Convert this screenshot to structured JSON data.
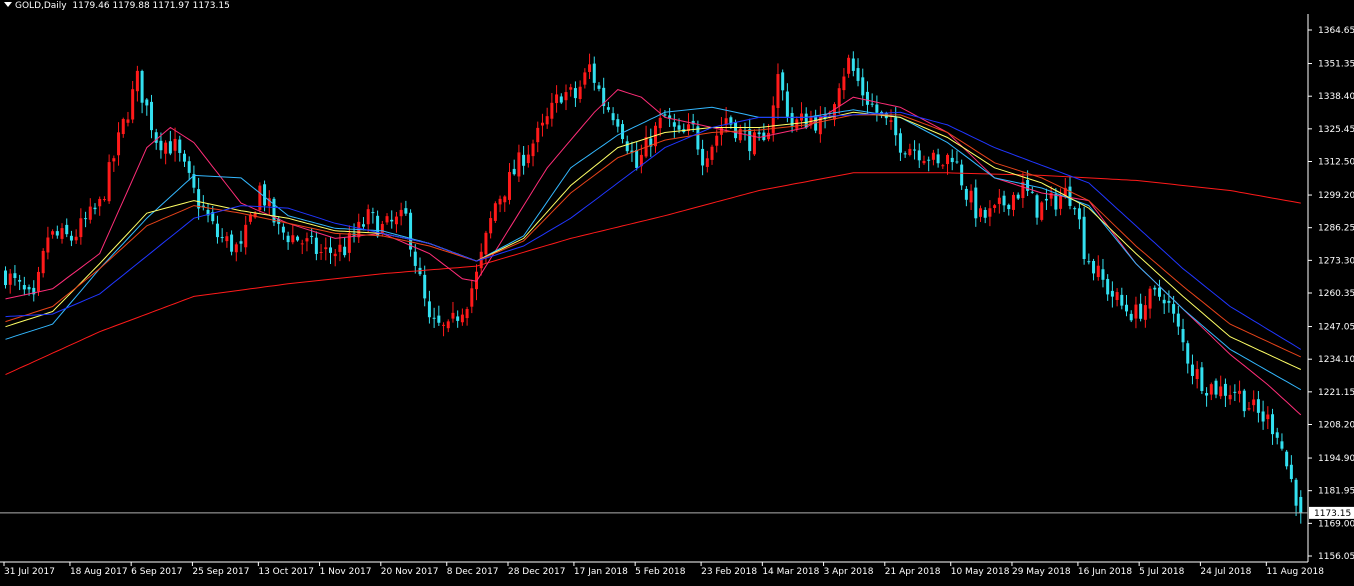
{
  "header": {
    "symbol": "GOLD,Daily",
    "ohlc": "1179.46 1179.88 1171.97 1173.15"
  },
  "chart_data": {
    "type": "candlestick",
    "symbol": "GOLD",
    "timeframe": "Daily",
    "ylim": [
      1151,
      1374
    ],
    "price_ticks": [
      "1364.65",
      "1351.35",
      "1338.40",
      "1325.45",
      "1312.50",
      "1299.20",
      "1286.25",
      "1273.30",
      "1260.35",
      "1247.05",
      "1234.10",
      "1221.15",
      "1208.20",
      "1194.90",
      "1181.95",
      "1169.00",
      "1156.05"
    ],
    "current_price": "1173.15",
    "date_ticks": [
      {
        "label": "31 Jul 2017",
        "index": 0
      },
      {
        "label": "18 Aug 2017",
        "index": 14
      },
      {
        "label": "6 Sep 2017",
        "index": 27
      },
      {
        "label": "25 Sep 2017",
        "index": 40
      },
      {
        "label": "13 Oct 2017",
        "index": 54
      },
      {
        "label": "1 Nov 2017",
        "index": 67
      },
      {
        "label": "20 Nov 2017",
        "index": 80
      },
      {
        "label": "8 Dec 2017",
        "index": 94
      },
      {
        "label": "28 Dec 2017",
        "index": 107
      },
      {
        "label": "17 Jan 2018",
        "index": 121
      },
      {
        "label": "5 Feb 2018",
        "index": 134
      },
      {
        "label": "23 Feb 2018",
        "index": 148
      },
      {
        "label": "14 Mar 2018",
        "index": 161
      },
      {
        "label": "3 Apr 2018",
        "index": 174
      },
      {
        "label": "21 Apr 2018",
        "index": 187
      },
      {
        "label": "10 May 2018",
        "index": 201
      },
      {
        "label": "29 May 2018",
        "index": 214
      },
      {
        "label": "16 Jun 2018",
        "index": 228
      },
      {
        "label": "5 Jul 2018",
        "index": 241
      },
      {
        "label": "24 Jul 2018",
        "index": 254
      },
      {
        "label": "11 Aug 2018",
        "index": 268
      }
    ],
    "close_path": [
      [
        0,
        1268
      ],
      [
        6,
        1256
      ],
      [
        9,
        1283
      ],
      [
        14,
        1282
      ],
      [
        20,
        1295
      ],
      [
        25,
        1327
      ],
      [
        28,
        1345
      ],
      [
        32,
        1322
      ],
      [
        36,
        1318
      ],
      [
        40,
        1300
      ],
      [
        45,
        1283
      ],
      [
        50,
        1277
      ],
      [
        54,
        1302
      ],
      [
        58,
        1285
      ],
      [
        62,
        1282
      ],
      [
        67,
        1276
      ],
      [
        72,
        1278
      ],
      [
        77,
        1290
      ],
      [
        80,
        1286
      ],
      [
        85,
        1290
      ],
      [
        88,
        1265
      ],
      [
        90,
        1248
      ],
      [
        94,
        1245
      ],
      [
        96,
        1252
      ],
      [
        98,
        1258
      ],
      [
        100,
        1267
      ],
      [
        104,
        1296
      ],
      [
        107,
        1305
      ],
      [
        110,
        1315
      ],
      [
        114,
        1325
      ],
      [
        118,
        1340
      ],
      [
        121,
        1338
      ],
      [
        124,
        1350
      ],
      [
        127,
        1336
      ],
      [
        130,
        1330
      ],
      [
        134,
        1310
      ],
      [
        137,
        1322
      ],
      [
        140,
        1330
      ],
      [
        143,
        1322
      ],
      [
        146,
        1325
      ],
      [
        148,
        1315
      ],
      [
        150,
        1320
      ],
      [
        153,
        1330
      ],
      [
        157,
        1322
      ],
      [
        161,
        1318
      ],
      [
        164,
        1346
      ],
      [
        167,
        1327
      ],
      [
        171,
        1330
      ],
      [
        174,
        1326
      ],
      [
        177,
        1345
      ],
      [
        179,
        1352
      ],
      [
        182,
        1340
      ],
      [
        185,
        1332
      ],
      [
        188,
        1325
      ],
      [
        190,
        1320
      ],
      [
        193,
        1318
      ],
      [
        196,
        1315
      ],
      [
        198,
        1310
      ],
      [
        201,
        1316
      ],
      [
        204,
        1300
      ],
      [
        207,
        1290
      ],
      [
        210,
        1292
      ],
      [
        213,
        1298
      ],
      [
        216,
        1302
      ],
      [
        219,
        1294
      ],
      [
        222,
        1296
      ],
      [
        225,
        1300
      ],
      [
        227,
        1298
      ],
      [
        229,
        1278
      ],
      [
        231,
        1270
      ],
      [
        234,
        1262
      ],
      [
        237,
        1255
      ],
      [
        240,
        1252
      ],
      [
        243,
        1258
      ],
      [
        246,
        1260
      ],
      [
        249,
        1245
      ],
      [
        252,
        1230
      ],
      [
        255,
        1224
      ],
      [
        258,
        1222
      ],
      [
        261,
        1222
      ],
      [
        264,
        1216
      ],
      [
        266,
        1212
      ],
      [
        268,
        1210
      ],
      [
        270,
        1206
      ],
      [
        272,
        1192
      ],
      [
        274,
        1180
      ],
      [
        275,
        1173
      ]
    ],
    "indicators": [
      {
        "color": "#ff1a1a",
        "values": [
          [
            0,
            1228
          ],
          [
            20,
            1245
          ],
          [
            40,
            1259
          ],
          [
            60,
            1264
          ],
          [
            80,
            1268
          ],
          [
            100,
            1271
          ],
          [
            120,
            1282
          ],
          [
            140,
            1291
          ],
          [
            160,
            1301
          ],
          [
            180,
            1308
          ],
          [
            200,
            1308
          ],
          [
            220,
            1307
          ],
          [
            240,
            1305
          ],
          [
            260,
            1301
          ],
          [
            275,
            1296
          ]
        ]
      },
      {
        "color": "#ff2d78",
        "values": [
          [
            0,
            1258
          ],
          [
            10,
            1262
          ],
          [
            20,
            1276
          ],
          [
            30,
            1318
          ],
          [
            35,
            1326
          ],
          [
            40,
            1320
          ],
          [
            50,
            1296
          ],
          [
            60,
            1288
          ],
          [
            70,
            1282
          ],
          [
            80,
            1284
          ],
          [
            90,
            1276
          ],
          [
            97,
            1266
          ],
          [
            100,
            1265
          ],
          [
            105,
            1280
          ],
          [
            115,
            1310
          ],
          [
            125,
            1332
          ],
          [
            130,
            1341
          ],
          [
            135,
            1338
          ],
          [
            140,
            1330
          ],
          [
            150,
            1326
          ],
          [
            160,
            1322
          ],
          [
            170,
            1326
          ],
          [
            180,
            1338
          ],
          [
            190,
            1334
          ],
          [
            200,
            1324
          ],
          [
            210,
            1306
          ],
          [
            220,
            1300
          ],
          [
            230,
            1297
          ],
          [
            240,
            1272
          ],
          [
            250,
            1254
          ],
          [
            260,
            1236
          ],
          [
            268,
            1224
          ],
          [
            275,
            1212
          ]
        ]
      },
      {
        "color": "#33b8ff",
        "values": [
          [
            0,
            1242
          ],
          [
            10,
            1248
          ],
          [
            20,
            1270
          ],
          [
            30,
            1290
          ],
          [
            40,
            1307
          ],
          [
            50,
            1306
          ],
          [
            60,
            1291
          ],
          [
            70,
            1286
          ],
          [
            80,
            1285
          ],
          [
            90,
            1280
          ],
          [
            100,
            1273
          ],
          [
            110,
            1283
          ],
          [
            120,
            1310
          ],
          [
            130,
            1323
          ],
          [
            140,
            1332
          ],
          [
            150,
            1334
          ],
          [
            160,
            1330
          ],
          [
            170,
            1330
          ],
          [
            180,
            1333
          ],
          [
            190,
            1330
          ],
          [
            200,
            1320
          ],
          [
            210,
            1306
          ],
          [
            220,
            1302
          ],
          [
            230,
            1295
          ],
          [
            240,
            1272
          ],
          [
            250,
            1254
          ],
          [
            260,
            1238
          ],
          [
            275,
            1222
          ]
        ]
      },
      {
        "color": "#ffff66",
        "values": [
          [
            0,
            1247
          ],
          [
            10,
            1253
          ],
          [
            20,
            1272
          ],
          [
            30,
            1292
          ],
          [
            40,
            1297
          ],
          [
            50,
            1293
          ],
          [
            60,
            1290
          ],
          [
            70,
            1285
          ],
          [
            80,
            1284
          ],
          [
            90,
            1280
          ],
          [
            100,
            1273
          ],
          [
            110,
            1282
          ],
          [
            120,
            1303
          ],
          [
            130,
            1318
          ],
          [
            140,
            1324
          ],
          [
            150,
            1326
          ],
          [
            160,
            1326
          ],
          [
            170,
            1328
          ],
          [
            180,
            1332
          ],
          [
            190,
            1330
          ],
          [
            200,
            1322
          ],
          [
            210,
            1310
          ],
          [
            220,
            1304
          ],
          [
            230,
            1294
          ],
          [
            240,
            1276
          ],
          [
            250,
            1259
          ],
          [
            260,
            1243
          ],
          [
            275,
            1230
          ]
        ]
      },
      {
        "color": "#e8431a",
        "values": [
          [
            0,
            1249
          ],
          [
            10,
            1255
          ],
          [
            20,
            1270
          ],
          [
            30,
            1287
          ],
          [
            40,
            1295
          ],
          [
            50,
            1292
          ],
          [
            60,
            1288
          ],
          [
            70,
            1284
          ],
          [
            80,
            1283
          ],
          [
            90,
            1279
          ],
          [
            100,
            1273
          ],
          [
            110,
            1281
          ],
          [
            120,
            1300
          ],
          [
            130,
            1314
          ],
          [
            140,
            1321
          ],
          [
            150,
            1324
          ],
          [
            160,
            1325
          ],
          [
            170,
            1327
          ],
          [
            180,
            1331
          ],
          [
            190,
            1331
          ],
          [
            200,
            1324
          ],
          [
            210,
            1312
          ],
          [
            220,
            1306
          ],
          [
            230,
            1297
          ],
          [
            240,
            1279
          ],
          [
            250,
            1263
          ],
          [
            260,
            1248
          ],
          [
            275,
            1235
          ]
        ]
      },
      {
        "color": "#2036ff",
        "values": [
          [
            0,
            1251
          ],
          [
            10,
            1252
          ],
          [
            20,
            1260
          ],
          [
            30,
            1275
          ],
          [
            40,
            1290
          ],
          [
            50,
            1295
          ],
          [
            60,
            1294
          ],
          [
            70,
            1288
          ],
          [
            80,
            1284
          ],
          [
            90,
            1280
          ],
          [
            100,
            1273
          ],
          [
            110,
            1279
          ],
          [
            120,
            1290
          ],
          [
            130,
            1304
          ],
          [
            140,
            1318
          ],
          [
            150,
            1326
          ],
          [
            160,
            1330
          ],
          [
            170,
            1330
          ],
          [
            180,
            1331
          ],
          [
            190,
            1332
          ],
          [
            200,
            1327
          ],
          [
            210,
            1318
          ],
          [
            220,
            1311
          ],
          [
            230,
            1304
          ],
          [
            240,
            1287
          ],
          [
            250,
            1270
          ],
          [
            260,
            1255
          ],
          [
            275,
            1238
          ]
        ]
      }
    ]
  },
  "colors": {
    "background": "#000000",
    "bull": "#ff1a1a",
    "bear": "#33e0f0",
    "axis": "#ffffff",
    "price_line": "#b0b0b0"
  }
}
